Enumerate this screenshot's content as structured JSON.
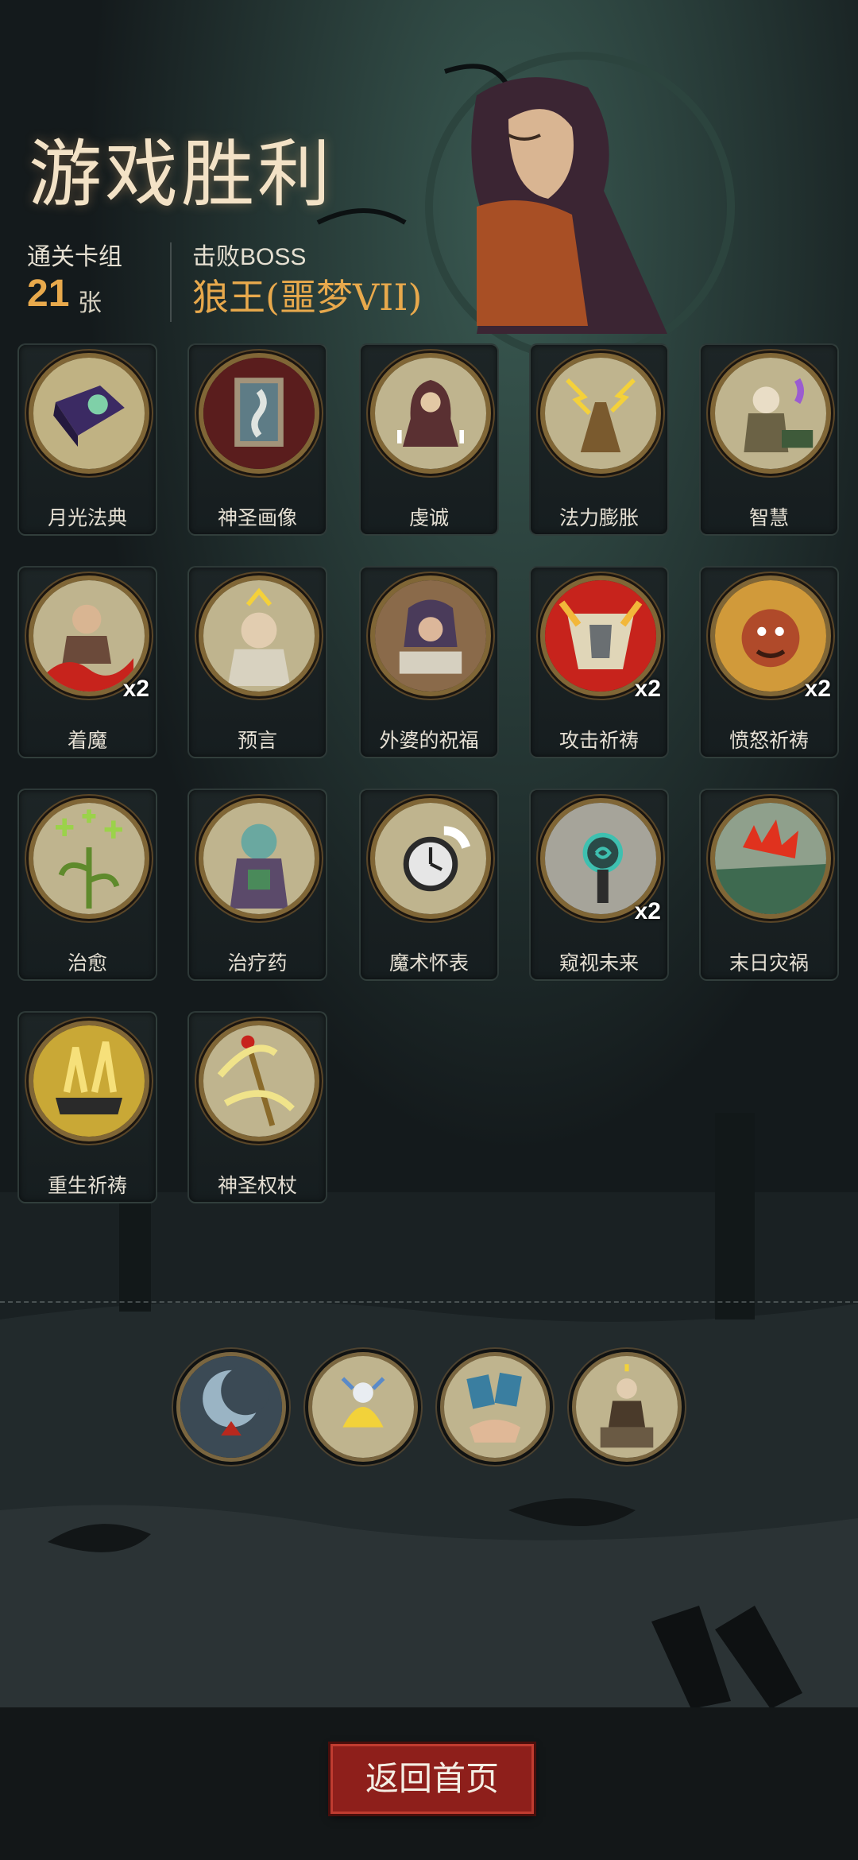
{
  "header": {
    "title": "游戏胜利",
    "deck_label": "通关卡组",
    "deck_count": "21",
    "deck_unit": "张",
    "boss_label": "击败BOSS",
    "boss_name": "狼王(噩梦VII)"
  },
  "cards": [
    {
      "name": "月光法典",
      "icon": "moon-tome-icon"
    },
    {
      "name": "神圣画像",
      "icon": "holy-portrait-icon"
    },
    {
      "name": "虔诚",
      "icon": "devotion-icon"
    },
    {
      "name": "法力膨胀",
      "icon": "mana-surge-icon"
    },
    {
      "name": "智慧",
      "icon": "wisdom-icon"
    },
    {
      "name": "着魔",
      "icon": "possessed-icon",
      "multiplier": "x2"
    },
    {
      "name": "预言",
      "icon": "prophecy-icon"
    },
    {
      "name": "外婆的祝福",
      "icon": "grandma-blessing-icon"
    },
    {
      "name": "攻击祈祷",
      "icon": "attack-prayer-icon",
      "multiplier": "x2"
    },
    {
      "name": "愤怒祈祷",
      "icon": "fury-prayer-icon",
      "multiplier": "x2"
    },
    {
      "name": "治愈",
      "icon": "heal-icon"
    },
    {
      "name": "治疗药",
      "icon": "potion-icon"
    },
    {
      "name": "魔术怀表",
      "icon": "pocket-watch-icon"
    },
    {
      "name": "窥视未来",
      "icon": "foresight-icon",
      "multiplier": "x2"
    },
    {
      "name": "末日灾祸",
      "icon": "doom-icon"
    },
    {
      "name": "重生祈祷",
      "icon": "rebirth-prayer-icon"
    },
    {
      "name": "神圣权杖",
      "icon": "holy-scepter-icon"
    }
  ],
  "relics": [
    {
      "icon": "crescent-moon-relic-icon"
    },
    {
      "icon": "spirit-burst-relic-icon"
    },
    {
      "icon": "card-hand-relic-icon"
    },
    {
      "icon": "preacher-relic-icon"
    }
  ],
  "footer": {
    "return_label": "返回首页"
  },
  "colors": {
    "accent": "#e8a94c",
    "button": "#8e1f1b",
    "background": "#141a1c"
  }
}
